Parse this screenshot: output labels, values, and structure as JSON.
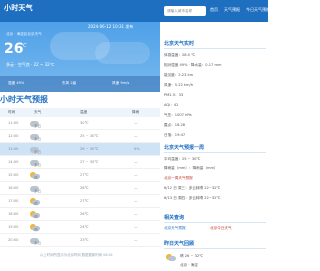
{
  "header": {
    "logo": "小时天气",
    "search_placeholder": "请输入城市名称",
    "nav": [
      "首页",
      "天气预报",
      "今日天气预报"
    ]
  },
  "hero": {
    "timestamp": "2024-06-12 10:31 发布",
    "location": "北京 · 海淀区北京天气",
    "temperature": "26",
    "deg": "℃",
    "condition": "多云 · 空气良 · 22 ~ 32℃",
    "strip": [
      "湿度 49%",
      "东风 2级",
      "风速 9m/s"
    ]
  },
  "forecast": {
    "title": "小时天气预报",
    "columns": [
      "时间",
      "天气",
      "温度",
      "降雨"
    ],
    "rows": [
      {
        "time": "11:00",
        "cond": "多云",
        "temp": "30℃",
        "rain": "—",
        "icon": "cloud-icon"
      },
      {
        "time": "12:00",
        "cond": "多云",
        "temp": "25 ~ 30℃",
        "rain": "—",
        "icon": "cloud-icon"
      },
      {
        "time": "13:00",
        "cond": "多云",
        "temp": "26 ~ 30℃",
        "rain": "0%",
        "icon": "cloud-icon"
      },
      {
        "time": "14:00",
        "cond": "多云",
        "temp": "27 ~ 30℃",
        "rain": "—",
        "icon": "cloud-icon"
      },
      {
        "time": "15:00",
        "cond": "晴",
        "temp": "27℃",
        "rain": "—",
        "icon": "sun-cloud-icon"
      },
      {
        "time": "16:00",
        "cond": "多云",
        "temp": "28℃",
        "rain": "—",
        "icon": "cloud-icon"
      },
      {
        "time": "17:00",
        "cond": "晴",
        "temp": "27℃",
        "rain": "—",
        "icon": "sun-cloud-icon"
      },
      {
        "time": "18:00",
        "cond": "晴",
        "temp": "26℃",
        "rain": "—",
        "icon": "sun-cloud-icon"
      },
      {
        "time": "19:00",
        "cond": "晴",
        "temp": "24℃",
        "rain": "—",
        "icon": "sun-cloud-icon"
      },
      {
        "time": "20:00",
        "cond": "多云",
        "temp": "23℃",
        "rain": "—",
        "icon": "cloud-icon"
      }
    ],
    "foot_note": "以上时间所显示为北京时间 数据更新时间 08:41"
  },
  "right": {
    "current_title": "北京天气实时",
    "current_rows": [
      "体感温度：28.0 ℃",
      "相对湿度 49% · 降水量：0.17 mm",
      "能见度：2.23 km",
      "风速：5.22 km/h",
      "PM2.5：33",
      "AQI：42",
      "气压：1007 hPa",
      "露点：18.28",
      "日落：19:47"
    ],
    "week_title": "北京天气预报一周",
    "week_rows": [
      "平均温度：25 ~ 30℃",
      "降雨量（mm）：降雨量（mm）",
      "北京一周天气预报"
    ],
    "week_links": [
      "6/12 日 周三：多云转晴 22~32℃",
      "6/13 日 周四：多云转晴 22~32℃"
    ],
    "hot_title": "相关查询",
    "hot_rows": [
      "北京天气预报",
      "北京今日天气"
    ],
    "today_title": "昨日天气回顾",
    "today_row": "晴 26 ~ 32℃",
    "today_sub": "北京 · 海淀"
  },
  "colors": {
    "brand": "#1e6fc0",
    "hero_top": "#4ea0e8",
    "highlight_row": "#cfe3f7"
  }
}
